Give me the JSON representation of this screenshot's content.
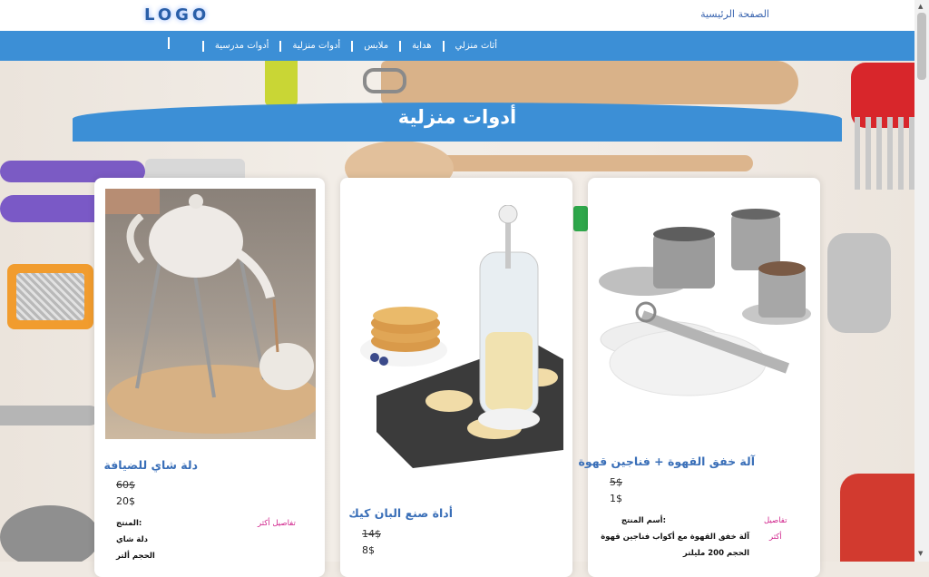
{
  "header": {
    "logo": "LOGO",
    "home": "الصفحة الرئيسية"
  },
  "nav": {
    "items": [
      "أدوات مدرسية",
      "أدوات منزلية",
      "ملابس",
      "هداية",
      "أثاث منزلي"
    ]
  },
  "banner": {
    "title": "أدوات منزلية"
  },
  "products": [
    {
      "title": "دلة شاي للضيافة",
      "old_price": "60$",
      "new_price": "20$",
      "details": "تفاصيل أكثر",
      "spec_label": ":المنتج",
      "spec_value": "دلة شاي",
      "spec_size": "الحجم ألتر"
    },
    {
      "title": "أداة صنع البان كيك",
      "old_price": "14$",
      "new_price": "8$"
    },
    {
      "title": "آلة خفق القهوة + فناجين قهوة",
      "old_price": "5$",
      "new_price": "1$",
      "details_1": "تفاصيل",
      "details_2": "أكثر",
      "spec_label": ":أسم المنتج",
      "spec_value": "آلة خفق القهوة مع أكواب فناجين قهوة",
      "spec_size": "الحجم 200 مليلتر"
    }
  ],
  "colors": {
    "nav_blue": "#3c8fd6",
    "title_blue": "#3a6fb8",
    "details_pink": "#d0208a"
  }
}
